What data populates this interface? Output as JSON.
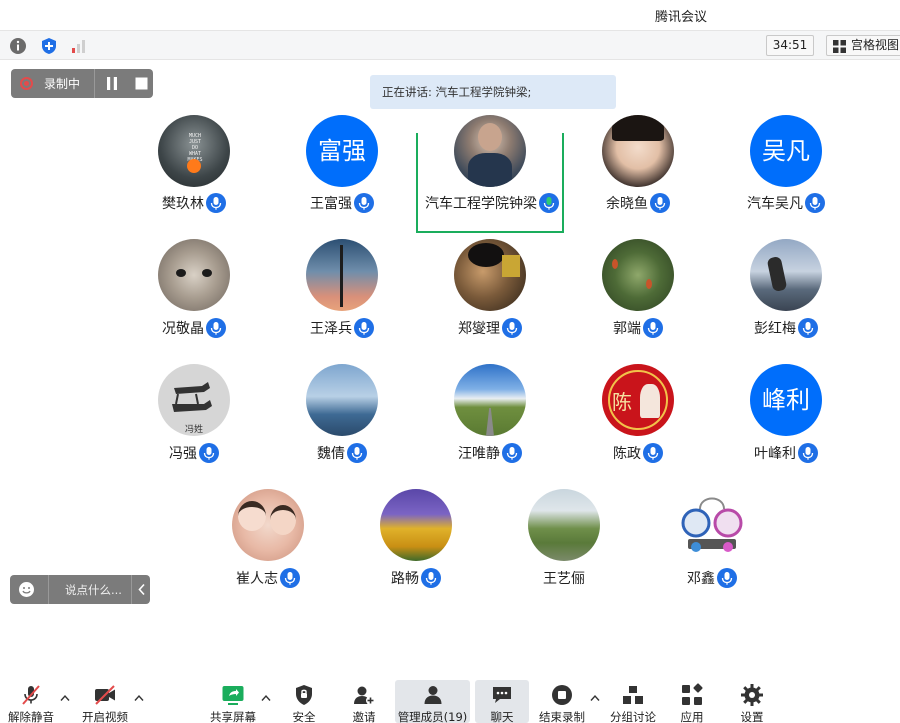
{
  "app": {
    "title": "腾讯会议"
  },
  "infobar": {
    "timer": "34:51",
    "view_label": "宫格视图"
  },
  "recording": {
    "label": "录制中"
  },
  "speaking": {
    "text": "正在讲话: 汽车工程学院钟梁;"
  },
  "participants": [
    {
      "name": "樊玖林",
      "avatar_text": ""
    },
    {
      "name": "王富强",
      "avatar_text": "富强"
    },
    {
      "name": "汽车工程学院钟梁",
      "avatar_text": ""
    },
    {
      "name": "余晓鱼",
      "avatar_text": ""
    },
    {
      "name": "汽车吴凡",
      "avatar_text": "吴凡"
    },
    {
      "name": "况敬晶",
      "avatar_text": ""
    },
    {
      "name": "王泽兵",
      "avatar_text": ""
    },
    {
      "name": "郑燮理",
      "avatar_text": ""
    },
    {
      "name": "郭端",
      "avatar_text": ""
    },
    {
      "name": "彭红梅",
      "avatar_text": ""
    },
    {
      "name": "冯强",
      "avatar_text": "冯姓"
    },
    {
      "name": "魏倩",
      "avatar_text": ""
    },
    {
      "name": "汪唯静",
      "avatar_text": ""
    },
    {
      "name": "陈政",
      "avatar_text": "陈"
    },
    {
      "name": "叶峰利",
      "avatar_text": "峰利"
    },
    {
      "name": "崔人志",
      "avatar_text": ""
    },
    {
      "name": "路畅",
      "avatar_text": ""
    },
    {
      "name": "王艺俪",
      "avatar_text": ""
    },
    {
      "name": "邓鑫",
      "avatar_text": ""
    }
  ],
  "chat": {
    "placeholder": "说点什么..."
  },
  "toolbar": {
    "unmute": "解除静音",
    "start_video": "开启视频",
    "share_screen": "共享屏幕",
    "security": "安全",
    "invite": "邀请",
    "manage_members": "管理成员(19)",
    "chat": "聊天",
    "end_recording": "结束录制",
    "breakout": "分组讨论",
    "apps": "应用",
    "settings": "设置"
  },
  "colors": {
    "accent": "#006efb",
    "mic_blue": "#1f6fe6",
    "active_border": "#1aad5c",
    "recording_red": "#e34b4b"
  }
}
